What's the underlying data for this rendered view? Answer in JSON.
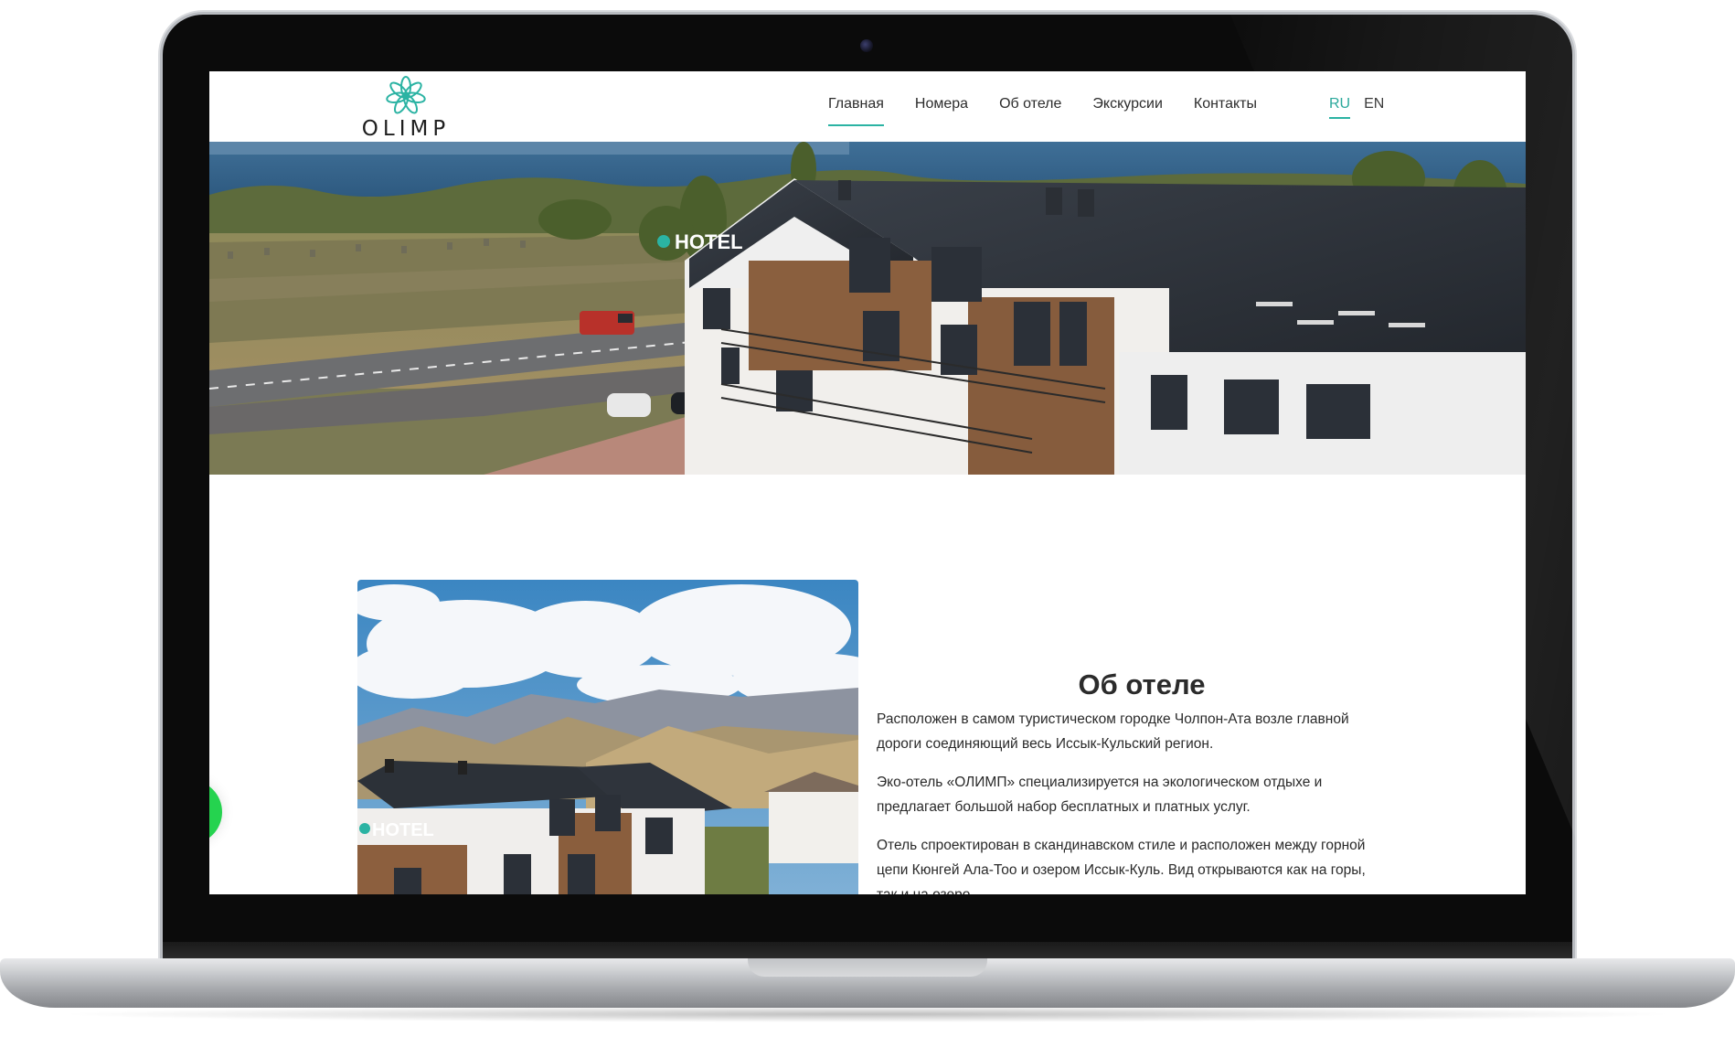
{
  "site": {
    "logo_text": "OLIMP",
    "brand_color": "#2bb3a3"
  },
  "nav": {
    "items": [
      {
        "label": "Главная",
        "active": true
      },
      {
        "label": "Номера",
        "active": false
      },
      {
        "label": "Об отеле",
        "active": false
      },
      {
        "label": "Экскурсии",
        "active": false
      },
      {
        "label": "Контакты",
        "active": false
      }
    ]
  },
  "lang": {
    "items": [
      {
        "label": "RU",
        "active": true
      },
      {
        "label": "EN",
        "active": false
      }
    ]
  },
  "hero": {
    "sign_text": "HOTEL"
  },
  "about": {
    "title": "Об отеле",
    "photo_sign_text": "HOTEL",
    "paragraphs": [
      "Расположен в самом туристическом городке Чолпон-Ата возле главной дороги соединяющий весь Иссык-Кульский регион.",
      "Эко-отель «ОЛИМП» специализируется на экологическом отдыхе и предлагает большой набор бесплатных и платных услуг.",
      "Отель спроектирован в скандинавском стиле и расположен между горной цепи Кюнгей Ала-Тоо и озером Иссык-Куль. Вид открываются как на горы, так и на озеро."
    ]
  }
}
